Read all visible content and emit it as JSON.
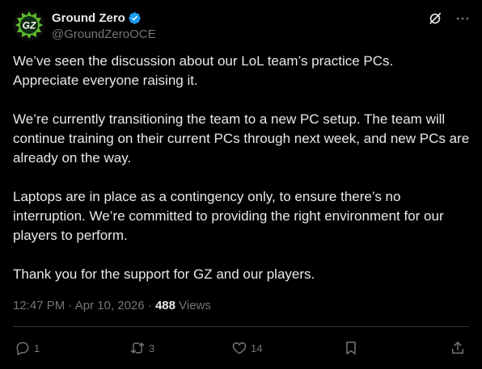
{
  "author": {
    "display_name": "Ground Zero",
    "handle": "@GroundZeroOCE",
    "avatar_text": "GZ",
    "verified": true
  },
  "icons": {
    "verified": "verified-badge-icon",
    "grok": "grok-icon",
    "more": "more-options-icon",
    "reply": "reply-icon",
    "repost": "repost-icon",
    "like": "heart-icon",
    "bookmark": "bookmark-icon",
    "share": "share-icon"
  },
  "tweet": {
    "paragraphs": [
      "We’ve seen the discussion about our LoL team’s practice PCs.\nAppreciate everyone raising it.",
      "We’re currently transitioning the team to a new PC setup. The team will continue training on their current PCs through next week, and new PCs are already on the way.",
      "Laptops are in place as a contingency only, to ensure there’s no interruption. We’re committed to providing the right environment for our players to perform.",
      "Thank you for the support for GZ and our players."
    ],
    "timestamp": "12:47 PM · Apr 10, 2026 · ",
    "views_count": "488",
    "views_label": " Views"
  },
  "stats": {
    "replies": "1",
    "reposts": "3",
    "likes": "14"
  },
  "colors": {
    "background": "#000000",
    "text": "#e7e9ea",
    "muted": "#71767b",
    "verified_blue": "#1d9bf0",
    "brand_green": "#5cb82e",
    "divider": "#2f3336"
  }
}
